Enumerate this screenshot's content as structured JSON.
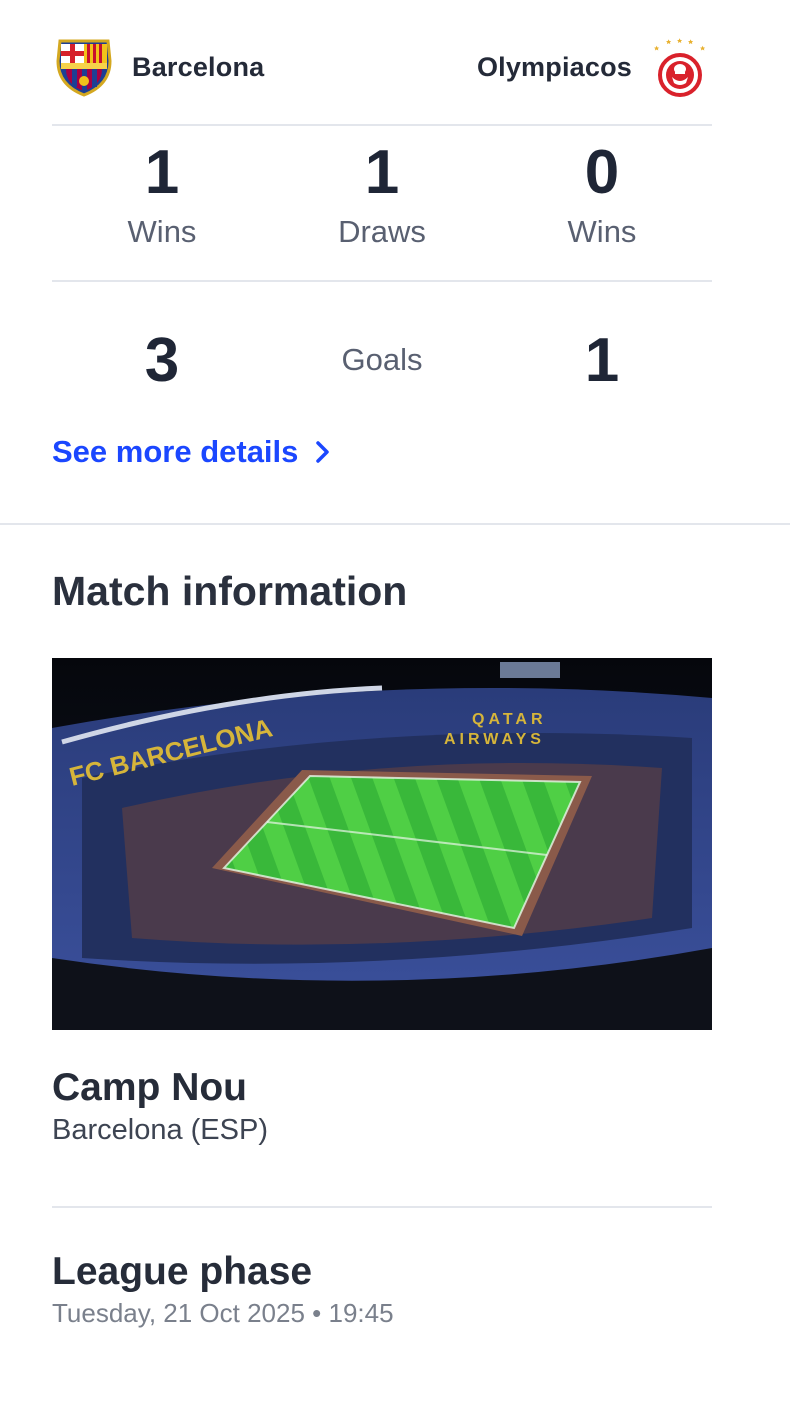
{
  "teams": {
    "home": {
      "name": "Barcelona",
      "crest_icon": "barcelona-crest-icon"
    },
    "away": {
      "name": "Olympiacos",
      "crest_icon": "olympiacos-crest-icon"
    }
  },
  "head_to_head": {
    "home_wins": {
      "value": "1",
      "label": "Wins"
    },
    "draws": {
      "value": "1",
      "label": "Draws"
    },
    "away_wins": {
      "value": "0",
      "label": "Wins"
    },
    "goals": {
      "home": "3",
      "label": "Goals",
      "away": "1"
    },
    "link_label": "See more details",
    "link_icon": "chevron-right-icon"
  },
  "match_info": {
    "title": "Match information",
    "stadium_image": {
      "sign_left": "FC BARCELONA",
      "sign_right_line1": "QATAR",
      "sign_right_line2": "AIRWAYS"
    },
    "venue_name": "Camp Nou",
    "venue_city": "Barcelona (ESP)",
    "phase": "League phase",
    "date_time": "Tuesday, 21 Oct 2025 • 19:45"
  },
  "colors": {
    "link": "#1b47ff",
    "text_primary": "#1f2636",
    "text_secondary": "#596071",
    "divider": "#e3e6ec"
  }
}
